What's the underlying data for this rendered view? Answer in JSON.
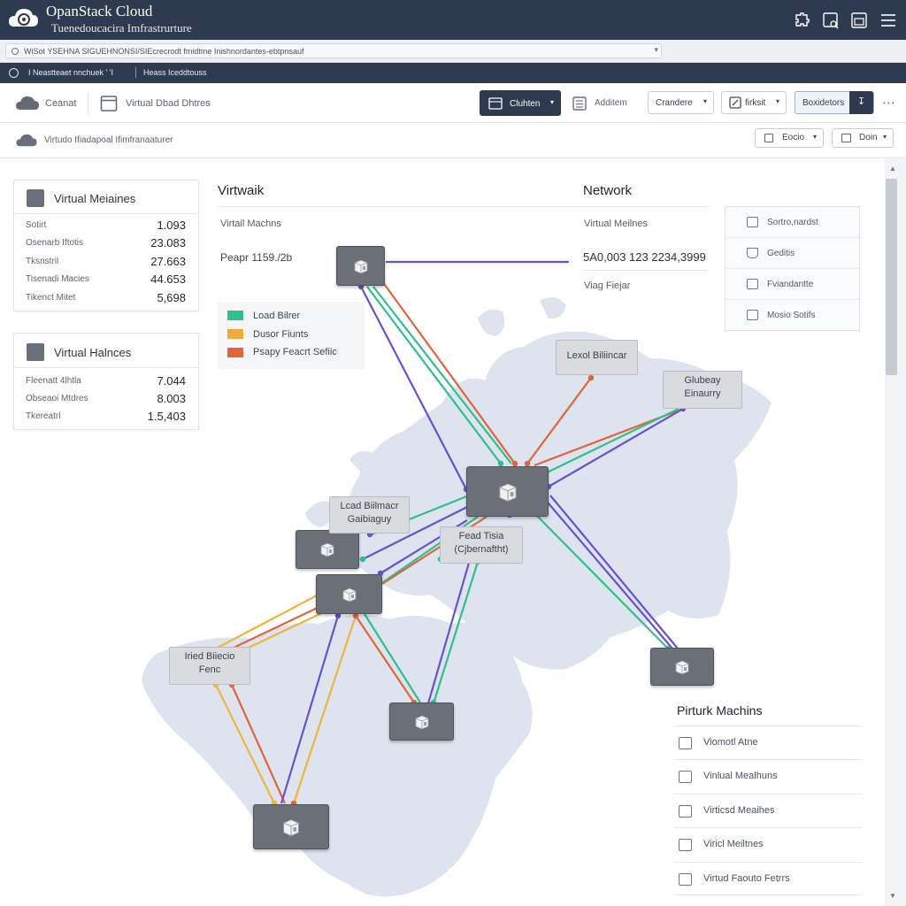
{
  "app": {
    "title": "OpanStack Cloud",
    "subtitle": "Tuenedoucacira Imfrastrurture"
  },
  "url": {
    "text": "WiSot YSEHNA SIGUEHNONSI/SIEcrecrodt fmidtme Inishnordantes-ebtpnsauf"
  },
  "nav": {
    "left": "I Neastteaet  nnchuek ' 'I",
    "right": "Heass Iceddtouss"
  },
  "toolbar": {
    "cloud_label": "Ceanat",
    "vm_label": "Virtual Dbad  Dhtres",
    "cluster_btn": "Cluhten",
    "addr_label": "Additem",
    "standard_btn": "Crandere",
    "network_btn": "firksit",
    "dropdown_btn": "Boxidetors"
  },
  "subbar": {
    "label": "Virtudo  Ifiadapoal Ifimfranaaturer",
    "btn1": "Eocio",
    "btn2": "Doin"
  },
  "card1": {
    "title": "Virtual Meiaines",
    "rows": [
      {
        "label": "Sotirt",
        "value": "1.093"
      },
      {
        "label": "Osenarb Iftotis",
        "value": "23.083"
      },
      {
        "label": "Tksnstril",
        "value": "27.663"
      },
      {
        "label": "Tisenadi Macies",
        "value": "44.653"
      },
      {
        "label": "Tikenct Mitet",
        "value": "5,698"
      }
    ]
  },
  "card2": {
    "title": "Virtual Halnces",
    "rows": [
      {
        "label": "Fleenatt 4lhtla",
        "value": "7.044"
      },
      {
        "label": "Obseaoi Mtdres",
        "value": "8.003"
      },
      {
        "label": "Tkereatrl",
        "value": "1.5,403"
      }
    ]
  },
  "section": {
    "left_title": "Virtwaik",
    "right_title": "Network",
    "left_sub": "Virtail Machns",
    "left_meta": "Peapr 1159./2b",
    "right_sub": "Virtual Meilnes",
    "right_meta": "5A0,003 123  2234,3999",
    "right_meta2": "Viag Fiejar"
  },
  "legend": [
    {
      "label": "Load Bilrer",
      "color": "#2fbf8a"
    },
    {
      "label": "Dusor Fiunts",
      "color": "#f0a93a"
    },
    {
      "label": "Psapy Feacrt Sefiic",
      "color": "#e0643c"
    }
  ],
  "side_list": [
    {
      "label": "Sortro,nardst",
      "icon": "server-icon"
    },
    {
      "label": "Geditis",
      "icon": "flask-icon"
    },
    {
      "label": "Fviandantte",
      "icon": "image-icon"
    },
    {
      "label": "Mosio Sotifs",
      "icon": "grid-icon"
    }
  ],
  "map_labels": {
    "l1": "Lexol Biliincar",
    "l2a": "Glubeay",
    "l2b": "Einaurry",
    "l3a": "Lcad Biilmacr",
    "l3b": "Gaibiaguy",
    "l4a": "Fead Tisia",
    "l4b": "(Cjbernaftht)",
    "l5a": "Iried Biiecio",
    "l5b": "Fenc"
  },
  "vm_list": {
    "title": "Pirturk Machins",
    "items": [
      "Viomotl Atne",
      "Vinlual Mealhuns",
      "Virticsd Meaihes",
      "Viricl Meiltnes",
      "Virtud Faouto Fetrrs"
    ]
  },
  "colors": {
    "green": "#2fbf8a",
    "purple": "#6a4fd0",
    "orange": "#e0643c",
    "yellow": "#f0b43a",
    "header": "#2d3a4f"
  }
}
